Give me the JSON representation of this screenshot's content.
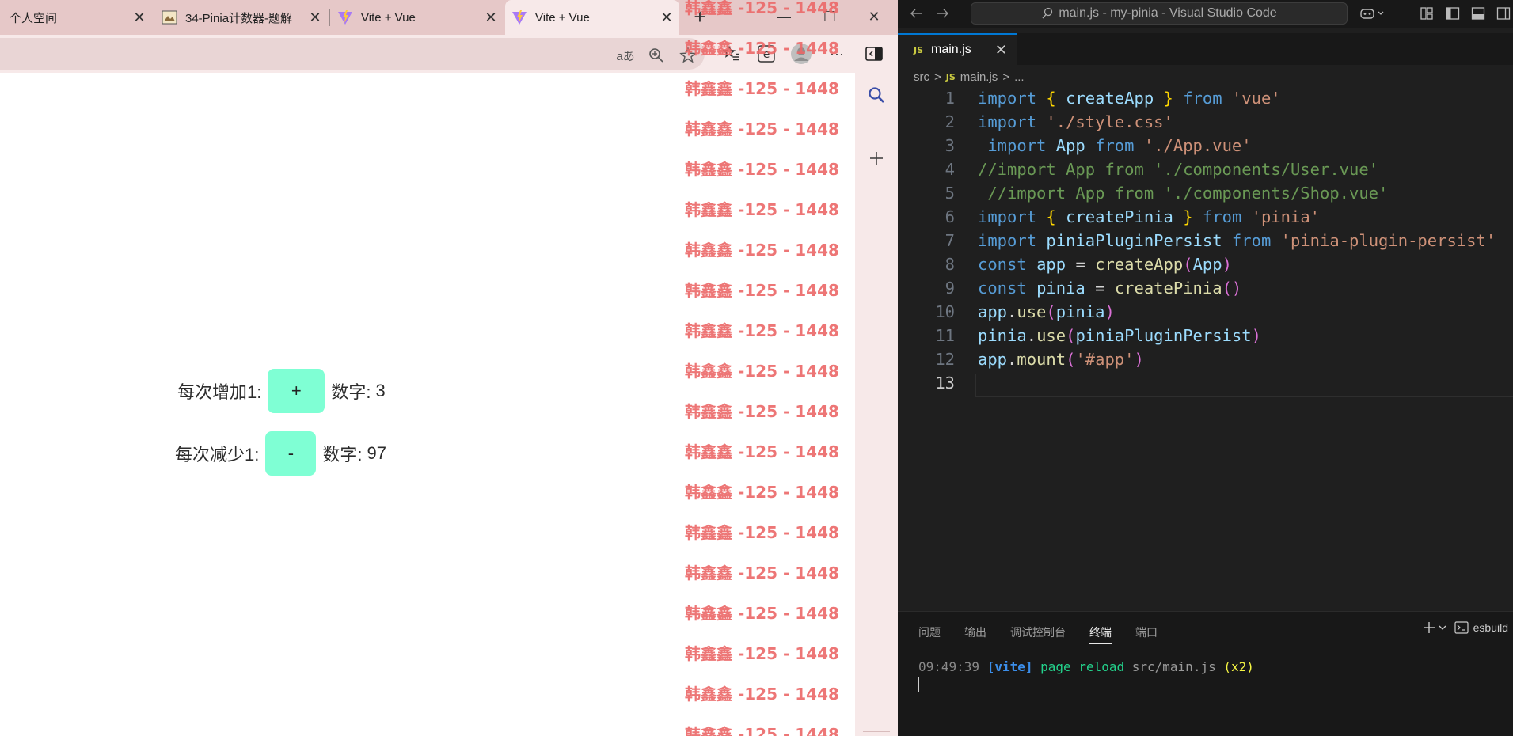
{
  "browser": {
    "tabs": [
      {
        "title": "个人空间"
      },
      {
        "title": "34-Pinia计数器-题解"
      },
      {
        "title": "Vite + Vue"
      },
      {
        "title": "Vite + Vue"
      }
    ],
    "tab_close": "✕",
    "new_tab": "+",
    "window_controls": {
      "minimize": "—",
      "maximize": "☐",
      "close": "✕"
    },
    "address_icons": {
      "read_aloud": "aあ"
    },
    "toolbar": {
      "more": "···"
    }
  },
  "page": {
    "increment": {
      "label": "每次增加1:",
      "button": "+",
      "value_label": "数字:",
      "value": "3"
    },
    "decrement": {
      "label": "每次减少1:",
      "button": "-",
      "value_label": "数字:",
      "value": "97"
    },
    "watermark": "韩鑫鑫 -125 - 1448"
  },
  "vscode": {
    "title": "main.js - my-pinia - Visual Studio Code",
    "tab": {
      "badge": "JS",
      "name": "main.js"
    },
    "breadcrumb": {
      "folder": "src",
      "sep": ">",
      "badge": "JS",
      "file": "main.js",
      "more": "..."
    },
    "code_lines": [
      "import { createApp } from 'vue'",
      "import './style.css'",
      " import App from './App.vue'",
      "//import App from './components/User.vue'",
      " //import App from './components/Shop.vue'",
      "import { createPinia } from 'pinia'",
      "import piniaPluginPersist from 'pinia-plugin-persist'",
      "const app = createApp(App)",
      "const pinia = createPinia()",
      "app.use(pinia)",
      "pinia.use(piniaPluginPersist)",
      "app.mount('#app')",
      ""
    ],
    "panel": {
      "tabs": [
        "问题",
        "输出",
        "调试控制台",
        "终端",
        "端口"
      ],
      "active_tab": "终端",
      "terminal_name": "esbuild",
      "terminal_line": {
        "time": "09:49:39",
        "tag": "[vite]",
        "msg": "page reload",
        "file": "src/main.js",
        "count": "(x2)"
      }
    }
  }
}
